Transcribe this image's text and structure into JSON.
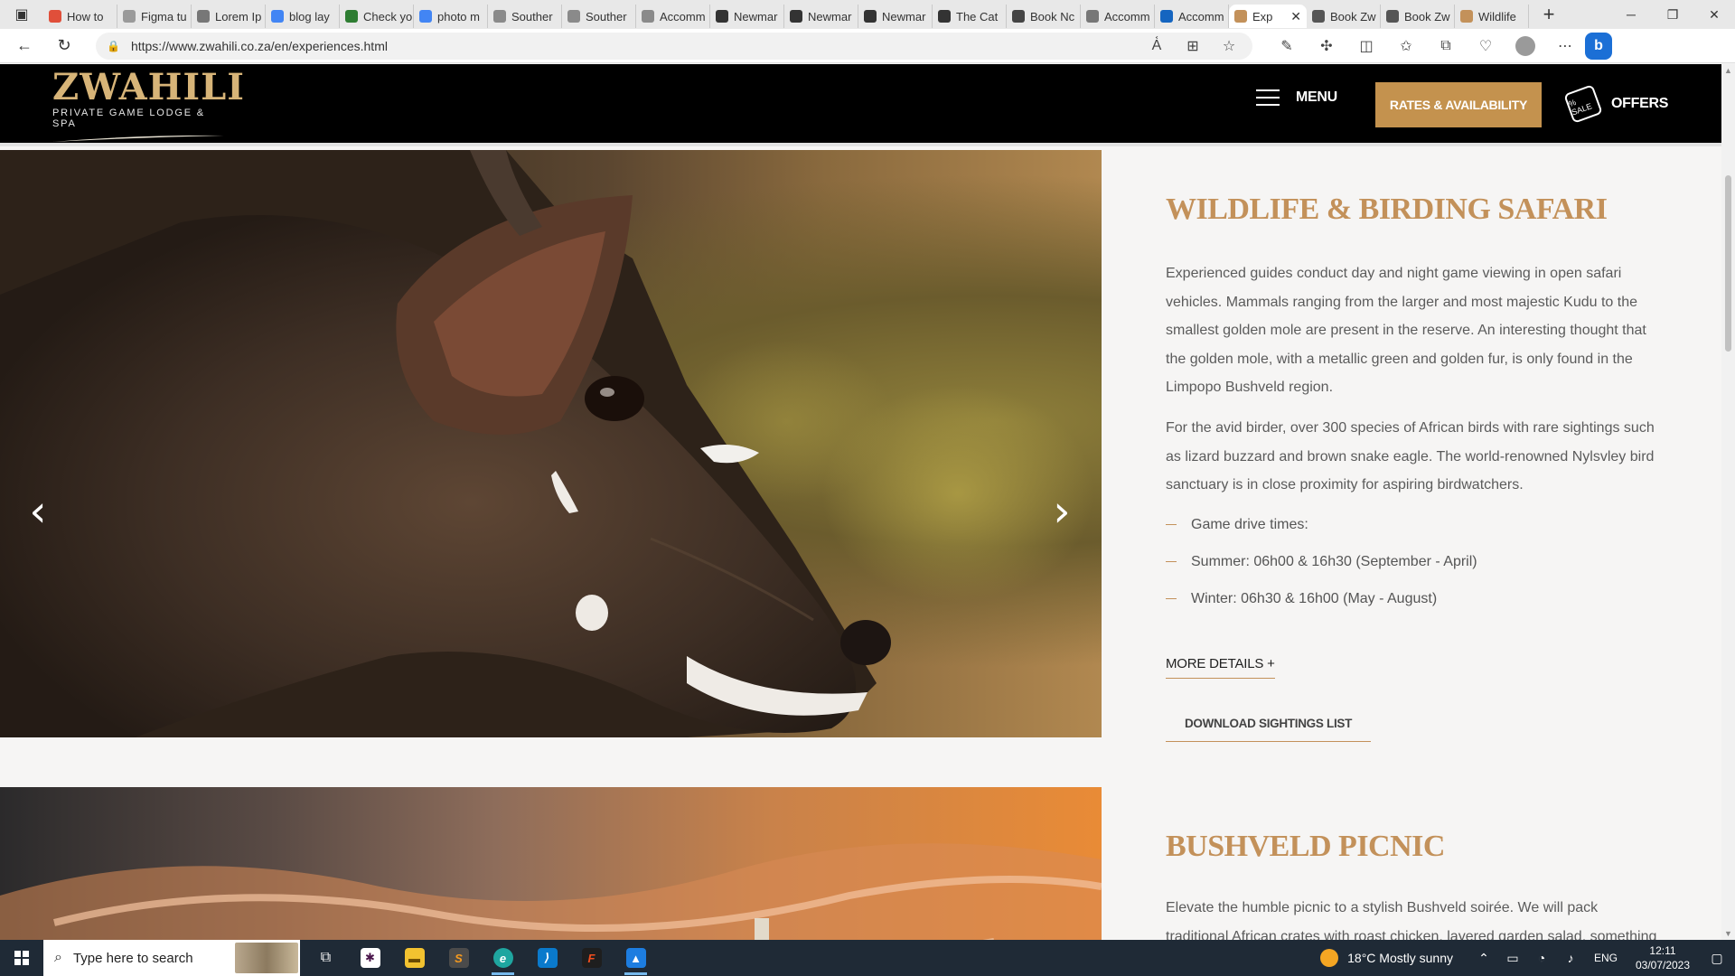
{
  "browser": {
    "tabs": [
      {
        "title": "How to",
        "icon": "figma-doc-icon",
        "color": "#e04f3a"
      },
      {
        "title": "Figma tu",
        "icon": "figma-page-icon",
        "color": "#9a9a9a"
      },
      {
        "title": "Lorem Ip",
        "icon": "lorem-page-icon",
        "color": "#777777"
      },
      {
        "title": "blog lay",
        "icon": "google-icon",
        "color": "#4285f4"
      },
      {
        "title": "Check yo",
        "icon": "check-circle-icon",
        "color": "#2e7d32"
      },
      {
        "title": "photo m",
        "icon": "google-icon",
        "color": "#4285f4"
      },
      {
        "title": "Souther",
        "icon": "site-icon",
        "color": "#8a8a8a"
      },
      {
        "title": "Souther",
        "icon": "site-icon",
        "color": "#8a8a8a"
      },
      {
        "title": "Accomm",
        "icon": "site-icon",
        "color": "#8a8a8a"
      },
      {
        "title": "Newmar",
        "icon": "newmark-icon",
        "color": "#333333"
      },
      {
        "title": "Newmar",
        "icon": "newmark-icon",
        "color": "#333333"
      },
      {
        "title": "Newmar",
        "icon": "newmark-icon",
        "color": "#333333"
      },
      {
        "title": "The Cat",
        "icon": "newmark-icon",
        "color": "#333333"
      },
      {
        "title": "Book Nc",
        "icon": "download-icon",
        "color": "#444444"
      },
      {
        "title": "Accomm",
        "icon": "doc-icon",
        "color": "#777777"
      },
      {
        "title": "Accomm",
        "icon": "wordpress-icon",
        "color": "#1565c0"
      },
      {
        "title": "Exp",
        "icon": "zwahili-icon",
        "color": "#c3915a",
        "active": true
      },
      {
        "title": "Book Zw",
        "icon": "tripadvisor-icon",
        "color": "#555555"
      },
      {
        "title": "Book Zw",
        "icon": "tripadvisor-icon",
        "color": "#555555"
      },
      {
        "title": "Wildlife",
        "icon": "zwahili-icon",
        "color": "#c3915a"
      }
    ],
    "url": "https://www.zwahili.co.za/en/experiences.html"
  },
  "site": {
    "logo": {
      "name": "ZWAHILI",
      "tagline": "PRIVATE GAME LODGE & SPA"
    },
    "menu_label": "MENU",
    "rates_label": "RATES & AVAILABILITY",
    "offers_label": "OFFERS",
    "offers_badge": "% SALE"
  },
  "section1": {
    "title": "WILDLIFE & BIRDING SAFARI",
    "para1": "Experienced guides conduct day and night game viewing in open safari vehicles. Mammals ranging from the larger and most majestic Kudu to the smallest golden mole are present in the reserve. An interesting thought that the golden mole, with a metallic green and golden fur, is only found in the Limpopo Bushveld region.",
    "para2": "For the avid birder, over 300 species of African birds with rare sightings such as lizard buzzard and brown snake eagle. The world-renowned Nylsvley bird sanctuary is in close proximity for aspiring birdwatchers.",
    "bullets": [
      "Game drive times:",
      "Summer: 06h00 & 16h30 (September - April)",
      "Winter: 06h30 & 16h00 (May - August)"
    ],
    "more_details": "MORE DETAILS +",
    "download": "DOWNLOAD SIGHTINGS LIST"
  },
  "section2": {
    "title": "BUSHVELD PICNIC",
    "para": "Elevate the humble picnic to a stylish Bushveld soirée. We will pack traditional African crates with roast chicken, layered garden salad, something sweet"
  },
  "colors": {
    "accent": "#c3915a",
    "header_bg": "#000000",
    "rates_bg": "#c4924e"
  },
  "taskbar": {
    "search_placeholder": "Type here to search",
    "weather": "18°C  Mostly sunny",
    "lang": "ENG",
    "time": "12:11",
    "date": "03/07/2023"
  }
}
